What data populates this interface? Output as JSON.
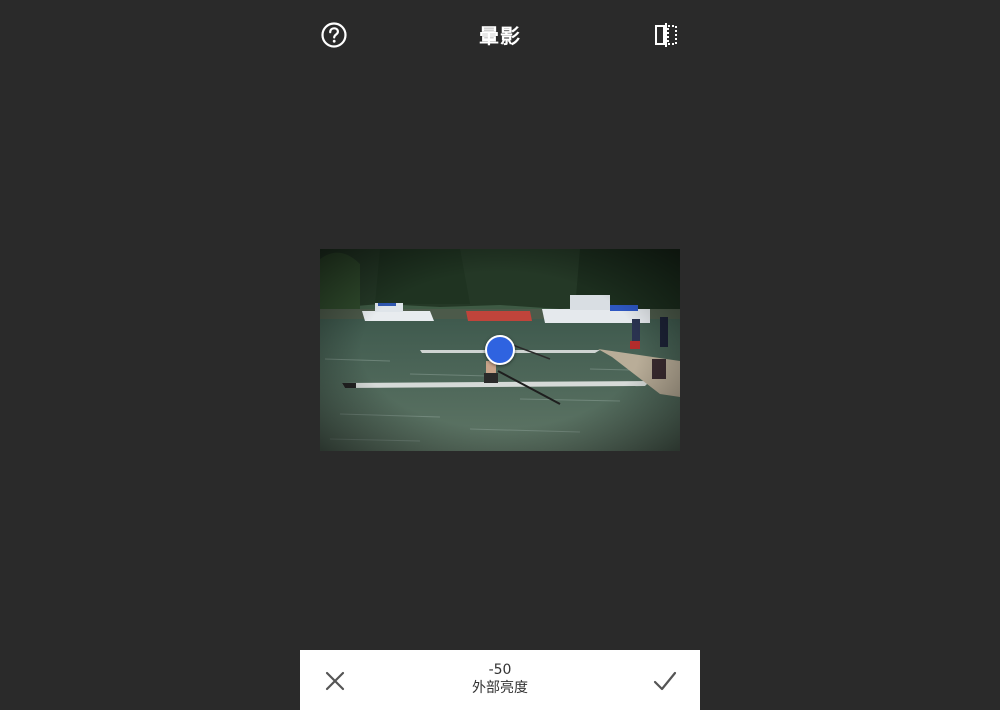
{
  "topbar": {
    "title": "暈影",
    "help_icon": "help-circle-icon",
    "compare_icon": "compare-split-icon"
  },
  "image": {
    "description_icon": "photo"
  },
  "control": {
    "value": "-50",
    "label": "外部亮度"
  },
  "bottombar": {
    "cancel_icon": "close-icon",
    "apply_icon": "check-icon"
  },
  "colors": {
    "background": "#2a2a2a",
    "bar": "#ffffff",
    "accent": "#2f63e0",
    "icon_light": "#ffffff",
    "icon_dark": "#555555"
  }
}
